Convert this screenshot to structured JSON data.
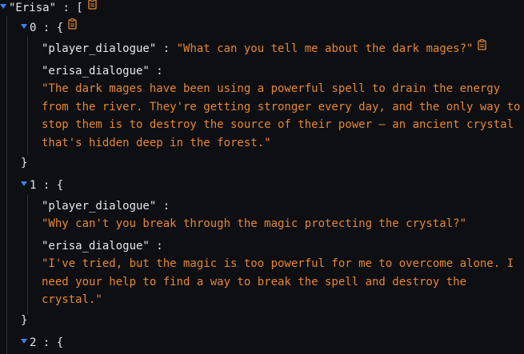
{
  "root": {
    "key": "\"Erisa\"",
    "open_bracket": "[",
    "colon": ":"
  },
  "entries": [
    {
      "index": "0",
      "open_brace": "{",
      "close_brace": "}",
      "player_key": "\"player_dialogue\"",
      "player_value": "\"What can you tell me about the dark mages?\"",
      "erisa_key": "\"erisa_dialogue\"",
      "erisa_value": "\"The dark mages have been using a powerful spell to drain the energy from the river. They're getting stronger every day, and the only way to stop them is to destroy the source of their power – an ancient crystal that's hidden deep in the forest.\""
    },
    {
      "index": "1",
      "open_brace": "{",
      "close_brace": "}",
      "player_key": "\"player_dialogue\"",
      "player_value": "\"Why can't you break through the magic protecting the crystal?\"",
      "erisa_key": "\"erisa_dialogue\"",
      "erisa_value": "\"I've tried, but the magic is too powerful for me to overcome alone. I need your help to find a way to break the spell and destroy the crystal.\""
    },
    {
      "index": "2",
      "open_brace": "{"
    }
  ],
  "colors": {
    "background": "#0d0f12",
    "key": "#e6e6e6",
    "string": "#e8862e",
    "caret": "#3b82f6",
    "guide": "#2d333b",
    "copy_icon": "#e8862e"
  },
  "icons": {
    "expand": "caret-down-icon",
    "copy": "clipboard-copy-icon"
  }
}
